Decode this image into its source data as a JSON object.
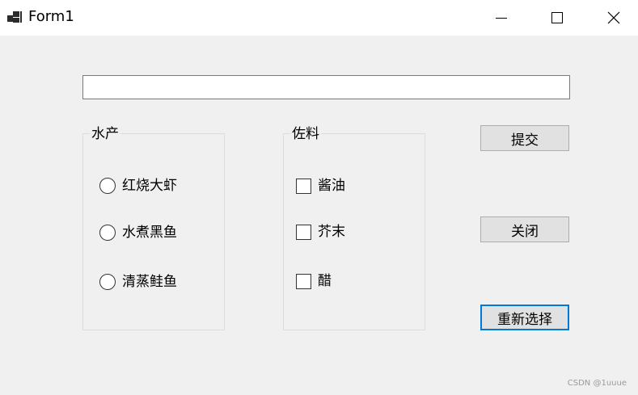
{
  "window": {
    "title": "Form1"
  },
  "textbox": {
    "value": ""
  },
  "group_seafood": {
    "caption": "水产",
    "options": [
      {
        "label": "红烧大虾",
        "checked": false
      },
      {
        "label": "水煮黑鱼",
        "checked": false
      },
      {
        "label": "清蒸鲑鱼",
        "checked": false
      }
    ]
  },
  "group_seasoning": {
    "caption": "佐料",
    "options": [
      {
        "label": "酱油",
        "checked": false
      },
      {
        "label": "芥末",
        "checked": false
      },
      {
        "label": "醋",
        "checked": false
      }
    ]
  },
  "buttons": {
    "submit": "提交",
    "close": "关闭",
    "reset": "重新选择"
  },
  "watermark": "CSDN @1uuue",
  "icons": {
    "app": "winforms-app-icon",
    "minimize": "minimize-icon",
    "maximize": "maximize-icon",
    "close": "close-icon"
  },
  "colors": {
    "background": "#f0f0f0",
    "titlebar": "#ffffff",
    "button": "#e1e1e1",
    "focus_border": "#0078d7"
  }
}
